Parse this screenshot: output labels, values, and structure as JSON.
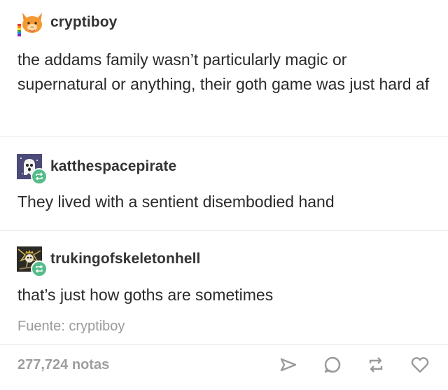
{
  "post": {
    "trail": [
      {
        "username": "cryptiboy",
        "avatar_icon": "orange-cat-pride-avatar-icon",
        "text": "the addams family wasn’t particularly magic or supernatural or anything, their goth game was just hard af"
      },
      {
        "username": "katthespacepirate",
        "avatar_icon": "ghost-avatar-icon",
        "text": "They lived with a sentient disembodied hand"
      },
      {
        "username": "trukingofskeletonhell",
        "avatar_icon": "skeleton-king-avatar-icon",
        "text": "that’s just how goths are sometimes"
      }
    ],
    "source": "Fuente: cryptiboy",
    "notes": "277,724 notas"
  },
  "icons": {
    "share": "share-icon",
    "reply": "reply-icon",
    "reblog": "reblog-icon",
    "like": "heart-icon"
  },
  "colors": {
    "reblog_badge": "#56bc8a",
    "icon_gray": "#9a9a9a",
    "divider": "#e6e6e6",
    "text": "#2a2a2a",
    "muted_text": "#9a9a9a"
  }
}
